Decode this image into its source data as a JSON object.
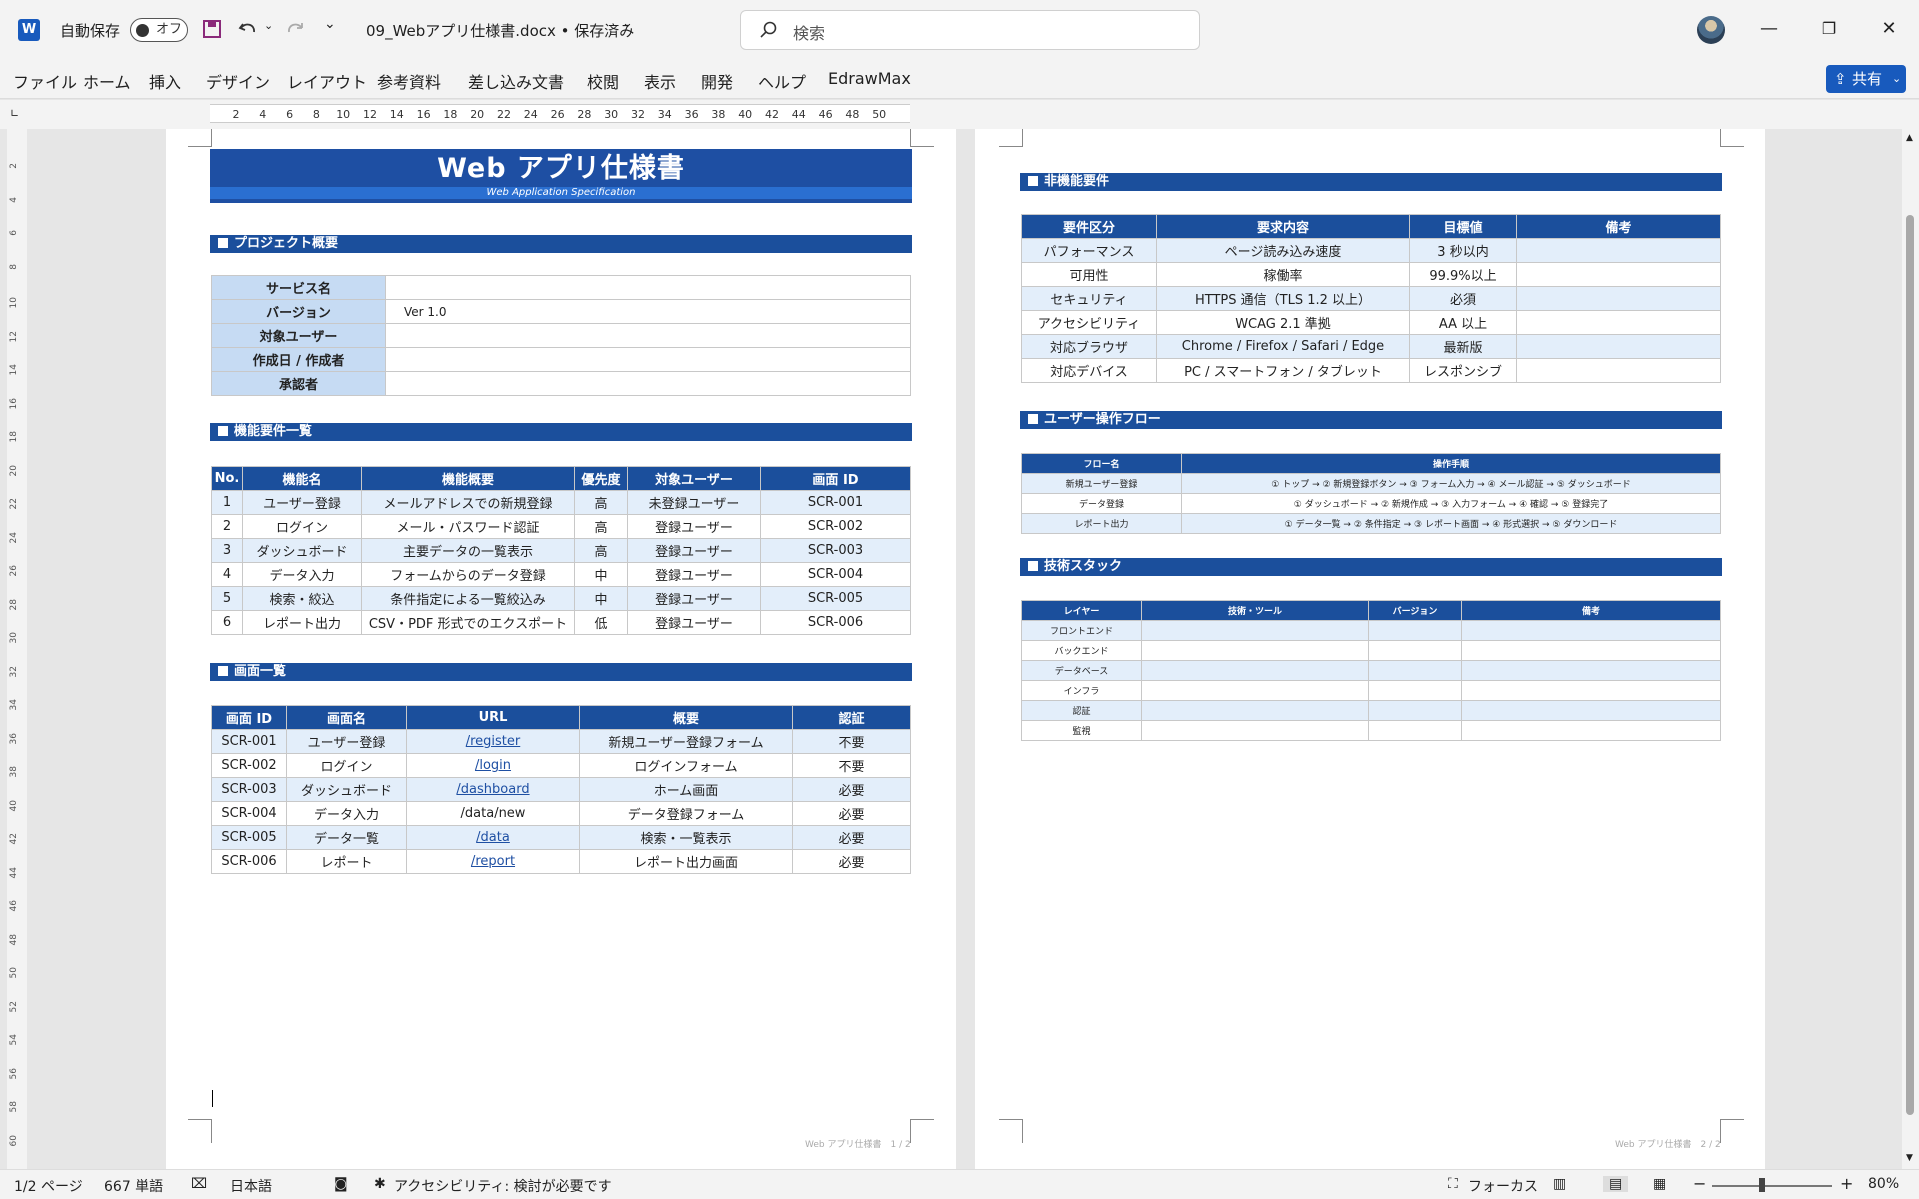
{
  "titlebar": {
    "app_icon": "W",
    "autosave_label": "自動保存",
    "autosave_state": "オフ",
    "doc_name": "09_Webアプリ仕様書.docx • 保存済み",
    "search_placeholder": "検索"
  },
  "menu": {
    "items": [
      "ファイル",
      "ホーム",
      "挿入",
      "デザイン",
      "レイアウト",
      "参考資料",
      "差し込み文書",
      "校閲",
      "表示",
      "開発",
      "ヘルプ",
      "EdrawMax"
    ],
    "share_label": "共有"
  },
  "ruler": {
    "ticks": [
      "2",
      "4",
      "6",
      "8",
      "10",
      "12",
      "14",
      "16",
      "18",
      "20",
      "22",
      "24",
      "26",
      "28",
      "30",
      "32",
      "34",
      "36",
      "38",
      "40",
      "42",
      "44",
      "46",
      "48",
      "50"
    ],
    "vticks": [
      "2",
      "4",
      "6",
      "8",
      "10",
      "12",
      "14",
      "16",
      "18",
      "20",
      "22",
      "24",
      "26",
      "28",
      "30",
      "32",
      "34",
      "36",
      "38",
      "40",
      "42",
      "44",
      "46",
      "48",
      "50",
      "52",
      "54",
      "56",
      "58",
      "60"
    ]
  },
  "page1": {
    "title": "Web アプリ仕様書",
    "subtitle": "Web Application Specification",
    "sections": {
      "overview": "プロジェクト概要",
      "features": "機能要件一覧",
      "screens": "画面一覧"
    },
    "overview_rows": [
      {
        "label": "サービス名",
        "value": ""
      },
      {
        "label": "バージョン",
        "value": "Ver 1.0"
      },
      {
        "label": "対象ユーザー",
        "value": ""
      },
      {
        "label": "作成日 / 作成者",
        "value": ""
      },
      {
        "label": "承認者",
        "value": ""
      }
    ],
    "features_headers": [
      "No.",
      "機能名",
      "機能概要",
      "優先度",
      "対象ユーザー",
      "画面 ID"
    ],
    "features_rows": [
      [
        "1",
        "ユーザー登録",
        "メールアドレスでの新規登録",
        "高",
        "未登録ユーザー",
        "SCR-001"
      ],
      [
        "2",
        "ログイン",
        "メール・パスワード認証",
        "高",
        "登録ユーザー",
        "SCR-002"
      ],
      [
        "3",
        "ダッシュボード",
        "主要データの一覧表示",
        "高",
        "登録ユーザー",
        "SCR-003"
      ],
      [
        "4",
        "データ入力",
        "フォームからのデータ登録",
        "中",
        "登録ユーザー",
        "SCR-004"
      ],
      [
        "5",
        "検索・絞込",
        "条件指定による一覧絞込み",
        "中",
        "登録ユーザー",
        "SCR-005"
      ],
      [
        "6",
        "レポート出力",
        "CSV・PDF 形式でのエクスポート",
        "低",
        "登録ユーザー",
        "SCR-006"
      ]
    ],
    "screens_headers": [
      "画面 ID",
      "画面名",
      "URL",
      "概要",
      "認証"
    ],
    "screens_rows": [
      [
        "SCR-001",
        "ユーザー登録",
        "/register",
        "新規ユーザー登録フォーム",
        "不要"
      ],
      [
        "SCR-002",
        "ログイン",
        "/login",
        "ログインフォーム",
        "不要"
      ],
      [
        "SCR-003",
        "ダッシュボード",
        "/dashboard",
        "ホーム画面",
        "必要"
      ],
      [
        "SCR-004",
        "データ入力",
        "/data/new",
        "データ登録フォーム",
        "必要"
      ],
      [
        "SCR-005",
        "データ一覧",
        "/data",
        "検索・一覧表示",
        "必要"
      ],
      [
        "SCR-006",
        "レポート",
        "/report",
        "レポート出力画面",
        "必要"
      ]
    ],
    "footer": "Web アプリ仕様書　1 / 2"
  },
  "page2": {
    "sections": {
      "nonfunc": "非機能要件",
      "flow": "ユーザー操作フロー",
      "stack": "技術スタック"
    },
    "nonfunc_headers": [
      "要件区分",
      "要求内容",
      "目標値",
      "備考"
    ],
    "nonfunc_rows": [
      [
        "パフォーマンス",
        "ページ読み込み速度",
        "3 秒以内",
        ""
      ],
      [
        "可用性",
        "稼働率",
        "99.9%以上",
        ""
      ],
      [
        "セキュリティ",
        "HTTPS 通信（TLS 1.2 以上）",
        "必須",
        ""
      ],
      [
        "アクセシビリティ",
        "WCAG 2.1 準拠",
        "AA 以上",
        ""
      ],
      [
        "対応ブラウザ",
        "Chrome / Firefox / Safari / Edge",
        "最新版",
        ""
      ],
      [
        "対応デバイス",
        "PC / スマートフォン / タブレット",
        "レスポンシブ",
        ""
      ]
    ],
    "flow_headers": [
      "フロー名",
      "操作手順"
    ],
    "flow_rows": [
      [
        "新規ユーザー登録",
        "① トップ → ② 新規登録ボタン → ③ フォーム入力 → ④ メール認証 → ⑤ ダッシュボード"
      ],
      [
        "データ登録",
        "① ダッシュボード → ② 新規作成 → ③ 入力フォーム → ④ 確認 → ⑤ 登録完了"
      ],
      [
        "レポート出力",
        "① データ一覧 → ② 条件指定 → ③ レポート画面 → ④ 形式選択 → ⑤ ダウンロード"
      ]
    ],
    "stack_headers": [
      "レイヤー",
      "技術・ツール",
      "バージョン",
      "備考"
    ],
    "stack_rows": [
      [
        "フロントエンド",
        "",
        "",
        ""
      ],
      [
        "バックエンド",
        "",
        "",
        ""
      ],
      [
        "データベース",
        "",
        "",
        ""
      ],
      [
        "インフラ",
        "",
        "",
        ""
      ],
      [
        "認証",
        "",
        "",
        ""
      ],
      [
        "監視",
        "",
        "",
        ""
      ]
    ],
    "footer": "Web アプリ仕様書　2 / 2"
  },
  "status": {
    "page": "1/2 ページ",
    "words": "667 単語",
    "language": "日本語",
    "accessibility": "アクセシビリティ: 検討が必要です",
    "focus": "フォーカス",
    "zoom": "80%"
  }
}
